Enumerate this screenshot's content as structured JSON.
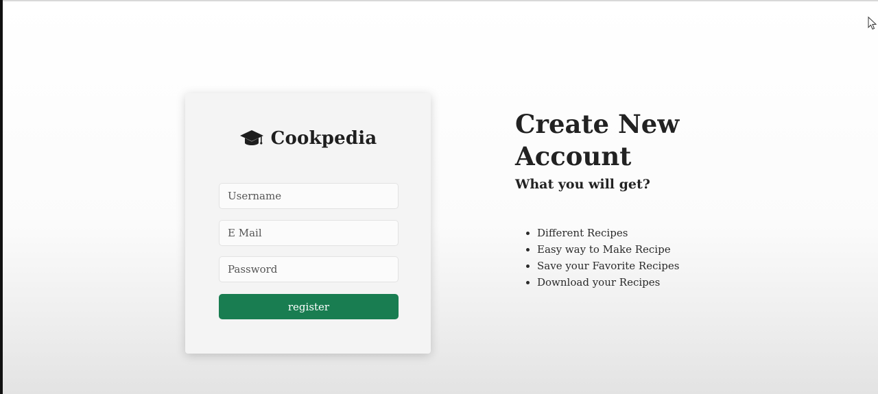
{
  "brand": {
    "name": "Cookpedia",
    "icon": "graduation-cap-icon"
  },
  "form": {
    "username_placeholder": "Username",
    "email_placeholder": "E Mail",
    "password_placeholder": "Password",
    "register_label": "register"
  },
  "info": {
    "title_line1": "Create New",
    "title_line2": "Account",
    "subtitle": "What you will get?",
    "benefits": [
      "Different Recipes",
      "Easy way to Make Recipe",
      "Save your Favorite Recipes",
      "Download your Recipes"
    ]
  },
  "colors": {
    "accent": "#197d51",
    "card_background": "#f4f4f4",
    "text": "#222222"
  }
}
